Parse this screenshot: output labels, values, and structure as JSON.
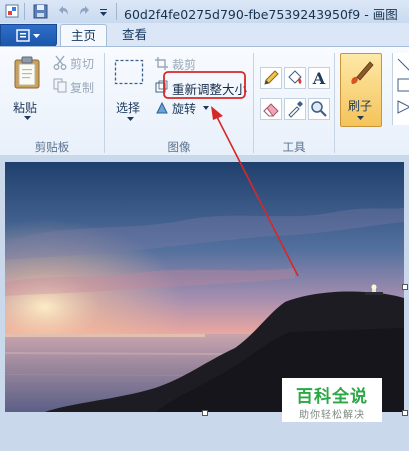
{
  "window": {
    "title": "60d2f4fe0275d790-fbe7539243950f9 - 画图"
  },
  "tabs": [
    {
      "label": "主页"
    },
    {
      "label": "查看"
    }
  ],
  "clipboard": {
    "paste_label": "粘贴",
    "cut_label": "剪切",
    "copy_label": "复制",
    "group_label": "剪贴板"
  },
  "image": {
    "select_label": "选择",
    "crop_label": "裁剪",
    "resize_label": "重新调整大小",
    "rotate_label": "旋转",
    "group_label": "图像"
  },
  "tools": {
    "group_label": "工具"
  },
  "brushes": {
    "label": "刷子"
  },
  "watermark": {
    "title": "百科全说",
    "subtitle": "助你轻松解决"
  },
  "colors": {
    "annotation": "#d62828",
    "accent": "#f2b33d"
  }
}
